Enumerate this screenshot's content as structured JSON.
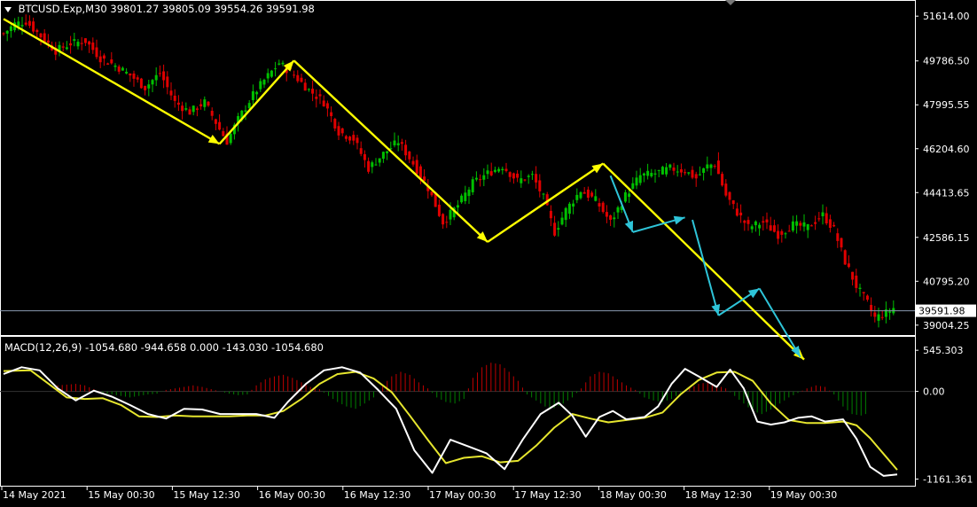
{
  "header": {
    "symbol": "BTCUSD.Exp,M30",
    "ohlc": "39801.27 39805.09 39554.26 39591.98"
  },
  "macd_header": {
    "label": "MACD(12,26,9) -1054.680 -944.658 0.000 -143.030 -1054.680"
  },
  "colors": {
    "background": "#000000",
    "bull": "#00c000",
    "bear": "#e00000",
    "trend_arrow": "#ffff00",
    "projection_arrow": "#2ec4d8",
    "macd_main": "#ffffff",
    "macd_signal": "#e6e62e",
    "hist_pos": "#c00000",
    "hist_neg": "#008000",
    "axis_text": "#ffffff",
    "grid": "#555555"
  },
  "chart_data": {
    "type": "line",
    "price_panel": {
      "y_ticks": [
        "51614.00",
        "49786.50",
        "47995.55",
        "46204.60",
        "44413.65",
        "42586.15",
        "40795.20",
        "39004.25"
      ],
      "ylim": [
        38600,
        52200
      ],
      "current_price": "39591.98",
      "x_ticks": [
        "14 May 2021",
        "15 May 00:30",
        "15 May 12:30",
        "16 May 00:30",
        "16 May 12:30",
        "17 May 00:30",
        "17 May 12:30",
        "18 May 00:30",
        "18 May 12:30",
        "19 May 00:30"
      ],
      "price_path": [
        [
          0,
          50900
        ],
        [
          3,
          51300
        ],
        [
          6,
          51400
        ],
        [
          10,
          50800
        ],
        [
          14,
          50200
        ],
        [
          18,
          50500
        ],
        [
          22,
          50600
        ],
        [
          26,
          49900
        ],
        [
          30,
          49600
        ],
        [
          34,
          49200
        ],
        [
          38,
          48700
        ],
        [
          42,
          49300
        ],
        [
          46,
          48100
        ],
        [
          50,
          47700
        ],
        [
          54,
          48100
        ],
        [
          58,
          47000
        ],
        [
          60,
          46500
        ],
        [
          63,
          47400
        ],
        [
          67,
          48400
        ],
        [
          70,
          49000
        ],
        [
          74,
          49700
        ],
        [
          78,
          49200
        ],
        [
          82,
          48600
        ],
        [
          86,
          48100
        ],
        [
          90,
          46900
        ],
        [
          94,
          46600
        ],
        [
          98,
          45400
        ],
        [
          102,
          46000
        ],
        [
          106,
          46500
        ],
        [
          110,
          45600
        ],
        [
          114,
          44600
        ],
        [
          118,
          43200
        ],
        [
          122,
          43900
        ],
        [
          126,
          44800
        ],
        [
          130,
          45200
        ],
        [
          134,
          45500
        ],
        [
          138,
          44900
        ],
        [
          142,
          45100
        ],
        [
          145,
          44200
        ],
        [
          148,
          42800
        ],
        [
          151,
          43700
        ],
        [
          155,
          44500
        ],
        [
          159,
          44100
        ],
        [
          163,
          43200
        ],
        [
          167,
          44300
        ],
        [
          171,
          45100
        ],
        [
          175,
          45200
        ],
        [
          179,
          45400
        ],
        [
          183,
          45300
        ],
        [
          186,
          45000
        ],
        [
          189,
          45500
        ],
        [
          191,
          45600
        ],
        [
          194,
          44300
        ],
        [
          197,
          43600
        ],
        [
          200,
          43000
        ],
        [
          204,
          43200
        ],
        [
          208,
          42700
        ],
        [
          212,
          43100
        ],
        [
          216,
          43000
        ],
        [
          220,
          43500
        ],
        [
          223,
          42900
        ],
        [
          226,
          41600
        ],
        [
          229,
          40600
        ],
        [
          232,
          39900
        ],
        [
          234,
          39300
        ],
        [
          237,
          39500
        ],
        [
          239,
          39700
        ]
      ],
      "arrows": [
        {
          "color": "yellow",
          "from": [
            0,
            51500
          ],
          "to": [
            58,
            46400
          ]
        },
        {
          "color": "yellow",
          "from": [
            58,
            46400
          ],
          "to": [
            78,
            49800
          ]
        },
        {
          "color": "yellow",
          "from": [
            78,
            49800
          ],
          "to": [
            130,
            42400
          ]
        },
        {
          "color": "yellow",
          "from": [
            130,
            42400
          ],
          "to": [
            161,
            45600
          ]
        },
        {
          "color": "yellow",
          "from": [
            161,
            45600
          ],
          "to": [
            215,
            37600
          ]
        },
        {
          "color": "cyan",
          "from": [
            163,
            45100
          ],
          "to": [
            169,
            42800
          ]
        },
        {
          "color": "cyan",
          "from": [
            169,
            42800
          ],
          "to": [
            183,
            43400
          ]
        },
        {
          "color": "cyan",
          "from": [
            185,
            43300
          ],
          "to": [
            192,
            39400
          ]
        },
        {
          "color": "cyan",
          "from": [
            192,
            39400
          ],
          "to": [
            203,
            40500
          ]
        },
        {
          "color": "cyan",
          "from": [
            203,
            40500
          ],
          "to": [
            214,
            37700
          ]
        }
      ]
    },
    "macd_panel": {
      "y_ticks": [
        "545.303",
        "0.00",
        "-1161.361"
      ],
      "ylim": [
        -1250,
        700
      ],
      "macd_main": [
        [
          0,
          230
        ],
        [
          4,
          320
        ],
        [
          8,
          280
        ],
        [
          12,
          40
        ],
        [
          16,
          -120
        ],
        [
          20,
          10
        ],
        [
          24,
          -70
        ],
        [
          28,
          -180
        ],
        [
          32,
          -300
        ],
        [
          36,
          -360
        ],
        [
          40,
          -230
        ],
        [
          44,
          -240
        ],
        [
          48,
          -300
        ],
        [
          52,
          -300
        ],
        [
          56,
          -300
        ],
        [
          60,
          -350
        ],
        [
          63,
          -140
        ],
        [
          67,
          100
        ],
        [
          71,
          280
        ],
        [
          75,
          320
        ],
        [
          79,
          250
        ],
        [
          83,
          20
        ],
        [
          87,
          -230
        ],
        [
          91,
          -780
        ],
        [
          95,
          -1080
        ],
        [
          99,
          -640
        ],
        [
          103,
          -730
        ],
        [
          107,
          -820
        ],
        [
          111,
          -1030
        ],
        [
          115,
          -640
        ],
        [
          119,
          -300
        ],
        [
          123,
          -150
        ],
        [
          126,
          -320
        ],
        [
          129,
          -600
        ],
        [
          132,
          -340
        ],
        [
          135,
          -260
        ],
        [
          138,
          -370
        ],
        [
          142,
          -340
        ],
        [
          145,
          -200
        ],
        [
          148,
          100
        ],
        [
          151,
          300
        ],
        [
          154,
          200
        ],
        [
          158,
          60
        ],
        [
          161,
          290
        ],
        [
          164,
          40
        ],
        [
          167,
          -400
        ],
        [
          170,
          -440
        ],
        [
          173,
          -410
        ],
        [
          176,
          -350
        ],
        [
          179,
          -330
        ],
        [
          182,
          -400
        ],
        [
          186,
          -370
        ],
        [
          189,
          -630
        ],
        [
          192,
          -1000
        ],
        [
          195,
          -1120
        ],
        [
          198,
          -1100
        ]
      ],
      "macd_signal": [
        [
          0,
          270
        ],
        [
          6,
          280
        ],
        [
          10,
          100
        ],
        [
          14,
          -80
        ],
        [
          18,
          -100
        ],
        [
          22,
          -90
        ],
        [
          26,
          -180
        ],
        [
          30,
          -330
        ],
        [
          34,
          -340
        ],
        [
          38,
          -320
        ],
        [
          42,
          -330
        ],
        [
          46,
          -330
        ],
        [
          50,
          -330
        ],
        [
          54,
          -320
        ],
        [
          58,
          -320
        ],
        [
          62,
          -260
        ],
        [
          66,
          -100
        ],
        [
          70,
          100
        ],
        [
          74,
          230
        ],
        [
          78,
          260
        ],
        [
          82,
          170
        ],
        [
          86,
          -10
        ],
        [
          90,
          -320
        ],
        [
          94,
          -640
        ],
        [
          98,
          -950
        ],
        [
          102,
          -880
        ],
        [
          106,
          -860
        ],
        [
          110,
          -940
        ],
        [
          114,
          -920
        ],
        [
          118,
          -720
        ],
        [
          122,
          -480
        ],
        [
          126,
          -300
        ],
        [
          130,
          -360
        ],
        [
          134,
          -410
        ],
        [
          138,
          -380
        ],
        [
          142,
          -350
        ],
        [
          146,
          -280
        ],
        [
          150,
          -40
        ],
        [
          154,
          150
        ],
        [
          158,
          250
        ],
        [
          162,
          260
        ],
        [
          166,
          140
        ],
        [
          170,
          -160
        ],
        [
          174,
          -380
        ],
        [
          178,
          -420
        ],
        [
          182,
          -420
        ],
        [
          186,
          -400
        ],
        [
          189,
          -450
        ],
        [
          192,
          -620
        ],
        [
          195,
          -830
        ],
        [
          198,
          -1040
        ]
      ],
      "histogram": [
        [
          12,
          80
        ],
        [
          14,
          90
        ],
        [
          16,
          100
        ],
        [
          18,
          80
        ],
        [
          20,
          30
        ],
        [
          22,
          -20
        ],
        [
          24,
          -40
        ],
        [
          26,
          -60
        ],
        [
          28,
          -80
        ],
        [
          30,
          -60
        ],
        [
          32,
          -40
        ],
        [
          34,
          -30
        ],
        [
          36,
          20
        ],
        [
          38,
          40
        ],
        [
          40,
          60
        ],
        [
          42,
          80
        ],
        [
          44,
          60
        ],
        [
          46,
          30
        ],
        [
          48,
          0
        ],
        [
          50,
          -30
        ],
        [
          52,
          -50
        ],
        [
          54,
          -40
        ],
        [
          56,
          80
        ],
        [
          58,
          160
        ],
        [
          60,
          200
        ],
        [
          62,
          220
        ],
        [
          64,
          180
        ],
        [
          66,
          120
        ],
        [
          68,
          60
        ],
        [
          70,
          30
        ],
        [
          72,
          -60
        ],
        [
          74,
          -140
        ],
        [
          76,
          -200
        ],
        [
          78,
          -230
        ],
        [
          80,
          -160
        ],
        [
          82,
          -80
        ],
        [
          84,
          80
        ],
        [
          86,
          200
        ],
        [
          88,
          260
        ],
        [
          90,
          220
        ],
        [
          92,
          120
        ],
        [
          94,
          40
        ],
        [
          96,
          -80
        ],
        [
          98,
          -140
        ],
        [
          100,
          -160
        ],
        [
          102,
          -100
        ],
        [
          104,
          180
        ],
        [
          106,
          320
        ],
        [
          108,
          380
        ],
        [
          110,
          360
        ],
        [
          112,
          260
        ],
        [
          114,
          140
        ],
        [
          116,
          -40
        ],
        [
          118,
          -120
        ],
        [
          120,
          -200
        ],
        [
          122,
          -220
        ],
        [
          124,
          -160
        ],
        [
          126,
          -80
        ],
        [
          128,
          40
        ],
        [
          130,
          200
        ],
        [
          132,
          260
        ],
        [
          134,
          240
        ],
        [
          136,
          160
        ],
        [
          138,
          80
        ],
        [
          140,
          20
        ],
        [
          142,
          -80
        ],
        [
          144,
          -120
        ],
        [
          146,
          -140
        ],
        [
          148,
          -100
        ],
        [
          150,
          -20
        ],
        [
          152,
          40
        ],
        [
          154,
          100
        ],
        [
          156,
          120
        ],
        [
          158,
          80
        ],
        [
          160,
          40
        ],
        [
          162,
          -60
        ],
        [
          164,
          -160
        ],
        [
          166,
          -260
        ],
        [
          168,
          -300
        ],
        [
          170,
          -240
        ],
        [
          172,
          -160
        ],
        [
          174,
          -80
        ],
        [
          176,
          -20
        ],
        [
          178,
          40
        ],
        [
          180,
          80
        ],
        [
          182,
          60
        ],
        [
          184,
          -40
        ],
        [
          186,
          -200
        ],
        [
          188,
          -300
        ],
        [
          190,
          -320
        ],
        [
          192,
          -280
        ]
      ]
    }
  }
}
